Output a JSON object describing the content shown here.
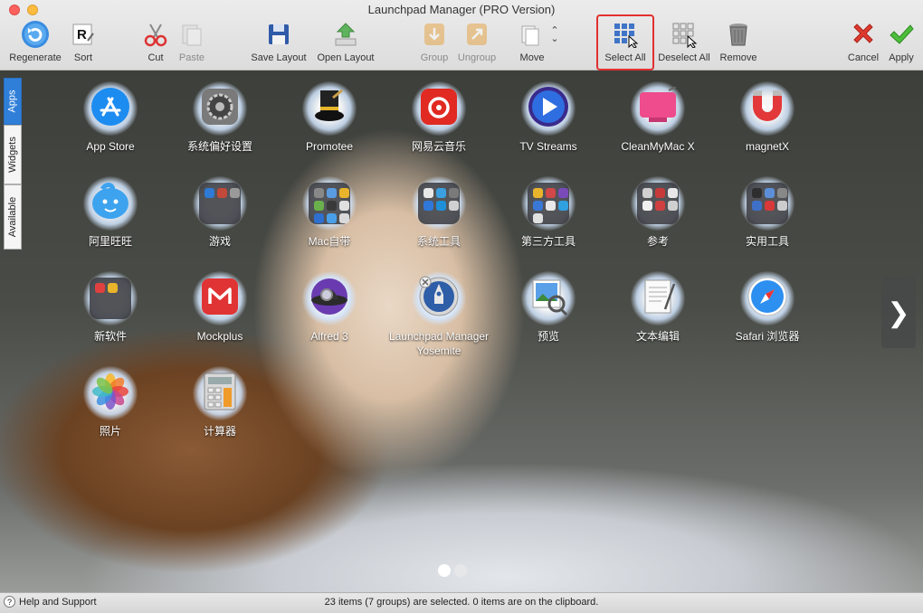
{
  "window": {
    "title": "Launchpad Manager (PRO Version)"
  },
  "toolbar": {
    "regenerate": "Regenerate",
    "sort": "Sort",
    "cut": "Cut",
    "paste": "Paste",
    "save_layout": "Save Layout",
    "open_layout": "Open Layout",
    "group": "Group",
    "ungroup": "Ungroup",
    "move": "Move",
    "select_all": "Select All",
    "deselect_all": "Deselect All",
    "remove": "Remove",
    "cancel": "Cancel",
    "apply": "Apply"
  },
  "sidebar": {
    "tabs": [
      "Apps",
      "Widgets",
      "Available"
    ],
    "active": "Apps"
  },
  "apps": [
    {
      "name": "App Store",
      "icon": "app-store-icon"
    },
    {
      "name": "系统偏好设置",
      "icon": "system-preferences-icon"
    },
    {
      "name": "Promotee",
      "icon": "promotee-icon"
    },
    {
      "name": "网易云音乐",
      "icon": "netease-music-icon"
    },
    {
      "name": "TV Streams",
      "icon": "tv-streams-icon"
    },
    {
      "name": "CleanMyMac X",
      "icon": "cleanmymac-icon"
    },
    {
      "name": "magnetX",
      "icon": "magnetx-icon"
    },
    {
      "name": "阿里旺旺",
      "icon": "aliwangwang-icon"
    },
    {
      "name": "游戏",
      "icon": "folder-icon"
    },
    {
      "name": "Mac自带",
      "icon": "folder-icon"
    },
    {
      "name": "系统工具",
      "icon": "folder-icon"
    },
    {
      "name": "第三方工具",
      "icon": "folder-icon"
    },
    {
      "name": "参考",
      "icon": "folder-icon"
    },
    {
      "name": "实用工具",
      "icon": "folder-icon"
    },
    {
      "name": "新软件",
      "icon": "folder-icon"
    },
    {
      "name": "Mockplus",
      "icon": "mockplus-icon"
    },
    {
      "name": "Alfred 3",
      "icon": "alfred-icon"
    },
    {
      "name": "Launchpad Manager Yosemite",
      "icon": "launchpad-manager-icon"
    },
    {
      "name": "预览",
      "icon": "preview-icon"
    },
    {
      "name": "文本编辑",
      "icon": "textedit-icon"
    },
    {
      "name": "Safari 浏览器",
      "icon": "safari-icon"
    },
    {
      "name": "照片",
      "icon": "photos-icon"
    },
    {
      "name": "计算器",
      "icon": "calculator-icon"
    }
  ],
  "pagination": {
    "pages": 2,
    "current": 1
  },
  "status": {
    "help": "Help and Support",
    "message": "23 items (7 groups) are selected. 0 items are on the clipboard."
  }
}
